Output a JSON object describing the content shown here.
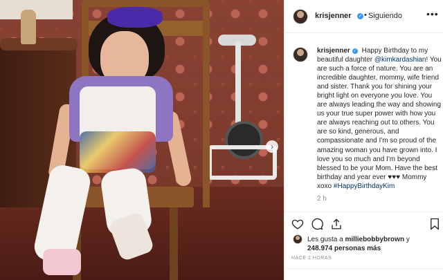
{
  "post": {
    "author": "krisjenner",
    "follow_label": "Siguiendo",
    "separator": "•",
    "more_label": "•••",
    "caption": {
      "username": "krisjenner",
      "text_before_mention": "Happy Birthday to my beautiful daughter",
      "mention": "@kimkardashian",
      "text_after_mention": "! You are such a force of nature. You are an incredible daughter, mommy, wife friend and sister. Thank you for shining your bright light on everyone you love. You are always leading the way and showing us your true super power with how you are always reaching out to others. You are so kind, generous, and compassionate and I'm so proud of the amazing woman you have grown into. I love you so much and I'm beyond blessed to be your Mom. Have the best birthday and year ever ♥♥♥ Mommy xoxo",
      "hashtag": "#HappyBirthdayKim"
    },
    "time_ago": "2 h",
    "likes": {
      "prefix": "Les gusta a",
      "first_user": "milliebobbybrown",
      "conjunction": "y",
      "others": "248.974 personas más"
    },
    "posted_label": "HACE 2 HORAS"
  },
  "icons": {
    "verified": "verified-badge-icon",
    "like": "heart-icon",
    "comment": "comment-icon",
    "share": "share-icon",
    "save": "bookmark-icon",
    "next": "chevron-right-icon"
  },
  "colors": {
    "verified": "#3897f0",
    "link": "#003569",
    "muted": "#8e8e8e"
  }
}
